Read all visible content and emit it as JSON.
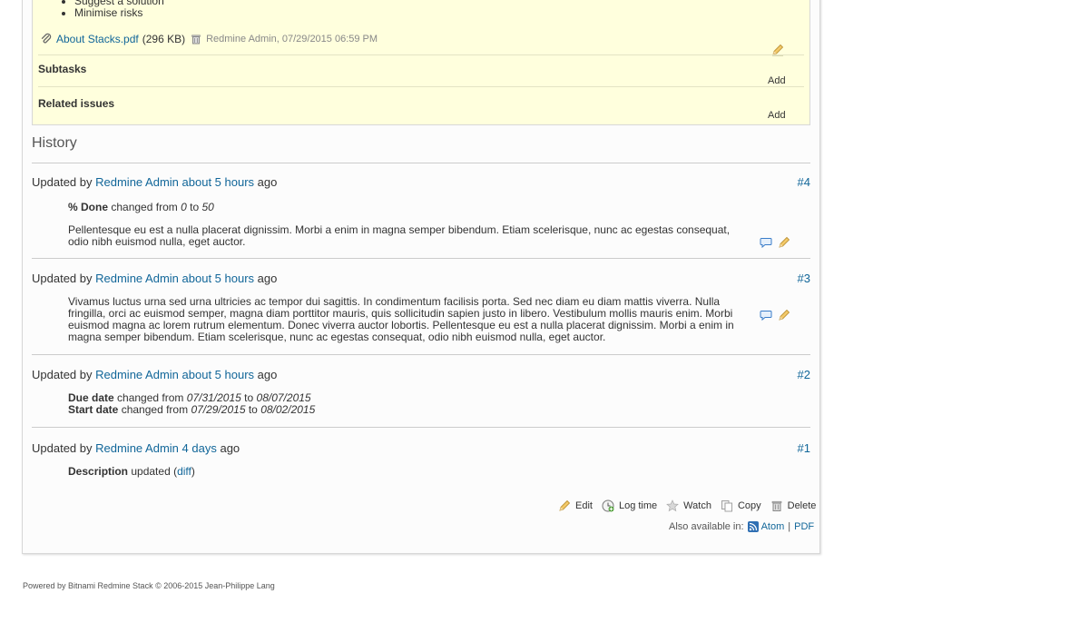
{
  "description": {
    "bullets": [
      "Suggest a solution",
      "Minimise risks"
    ]
  },
  "attachment": {
    "filename": "About Stacks.pdf",
    "size": "(296 KB)",
    "author_date": "Redmine Admin, 07/29/2015 06:59 PM"
  },
  "subtasks": {
    "heading": "Subtasks",
    "add_label": "Add"
  },
  "related": {
    "heading": "Related issues",
    "add_label": "Add"
  },
  "history": {
    "title": "History",
    "journals": [
      {
        "prefix": "Updated by",
        "author": "Redmine Admin",
        "time": "about 5 hours",
        "suffix": "ago",
        "number": "#4",
        "changes": [
          {
            "field": "% Done",
            "text": "changed from",
            "from": "0",
            "to_word": "to",
            "to": "50"
          }
        ],
        "note": "Pellentesque eu est a nulla placerat dignissim. Morbi a enim in magna semper bibendum. Etiam scelerisque, nunc ac egestas consequat, odio nibh euismod nulla, eget auctor."
      },
      {
        "prefix": "Updated by",
        "author": "Redmine Admin",
        "time": "about 5 hours",
        "suffix": "ago",
        "number": "#3",
        "note": "Vivamus luctus urna sed urna ultricies ac tempor dui sagittis. In condimentum facilisis porta. Sed nec diam eu diam mattis viverra. Nulla fringilla, orci ac euismod semper, magna diam porttitor mauris, quis sollicitudin sapien justo in libero. Vestibulum mollis mauris enim. Morbi euismod magna ac lorem rutrum elementum. Donec viverra auctor lobortis. Pellentesque eu est a nulla placerat dignissim. Morbi a enim in magna semper bibendum. Etiam scelerisque, nunc ac egestas consequat, odio nibh euismod nulla, eget auctor."
      },
      {
        "prefix": "Updated by",
        "author": "Redmine Admin",
        "time": "about 5 hours",
        "suffix": "ago",
        "number": "#2",
        "changes": [
          {
            "field": "Due date",
            "text": "changed from",
            "from": "07/31/2015",
            "to_word": "to",
            "to": "08/07/2015"
          },
          {
            "field": "Start date",
            "text": "changed from",
            "from": "07/29/2015",
            "to_word": "to",
            "to": "08/02/2015"
          }
        ]
      },
      {
        "prefix": "Updated by",
        "author": "Redmine Admin",
        "time": "4 days",
        "suffix": "ago",
        "number": "#1",
        "changes": [
          {
            "field": "Description",
            "text": "updated (",
            "link": "diff",
            "close": ")"
          }
        ]
      }
    ]
  },
  "actions": {
    "edit": "Edit",
    "log_time": "Log time",
    "watch": "Watch",
    "copy": "Copy",
    "delete": "Delete"
  },
  "other_formats": {
    "label": "Also available in:",
    "atom": "Atom",
    "separator": "|",
    "pdf": "PDF"
  },
  "footer": {
    "text": "Powered by Bitnami Redmine Stack © 2006-2015 Jean-Philippe Lang"
  },
  "colors": {
    "link": "#116699",
    "issue_bg": "#ffffdd",
    "panel_bg": "#fcfcfc"
  }
}
